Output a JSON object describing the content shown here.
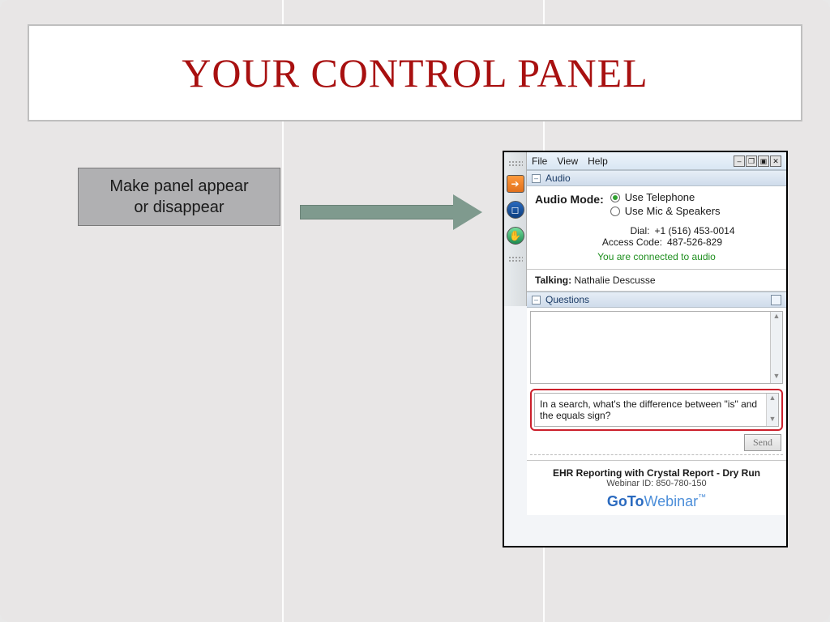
{
  "slide": {
    "title": "YOUR CONTROL PANEL",
    "callout": "Make panel appear\nor disappear"
  },
  "panel": {
    "menus": {
      "file": "File",
      "view": "View",
      "help": "Help"
    },
    "window_buttons": {
      "minimize": "–",
      "restore": "❐",
      "dock": "▣",
      "close": "✕"
    },
    "sections": {
      "audio": {
        "title": "Audio",
        "mode_label": "Audio Mode:",
        "options": {
          "telephone": "Use Telephone",
          "mic_speakers": "Use Mic & Speakers"
        },
        "selected": "telephone",
        "dial_label": "Dial:",
        "dial_number": "+1 (516) 453-0014",
        "access_label": "Access Code:",
        "access_code": "487-526-829",
        "connected_msg": "You are connected to audio"
      },
      "talking": {
        "label": "Talking:",
        "name": "Nathalie Descusse"
      },
      "questions": {
        "title": "Questions",
        "input_text": "In a search, what's the difference between \"is\" and the equals sign?",
        "send_label": "Send"
      }
    },
    "footer": {
      "session_title": "EHR Reporting with Crystal Report - Dry Run",
      "webinar_id_label": "Webinar ID:",
      "webinar_id": "850-780-150",
      "brand_goto": "GoTo",
      "brand_webinar": "Webinar",
      "brand_tm": "™"
    }
  }
}
